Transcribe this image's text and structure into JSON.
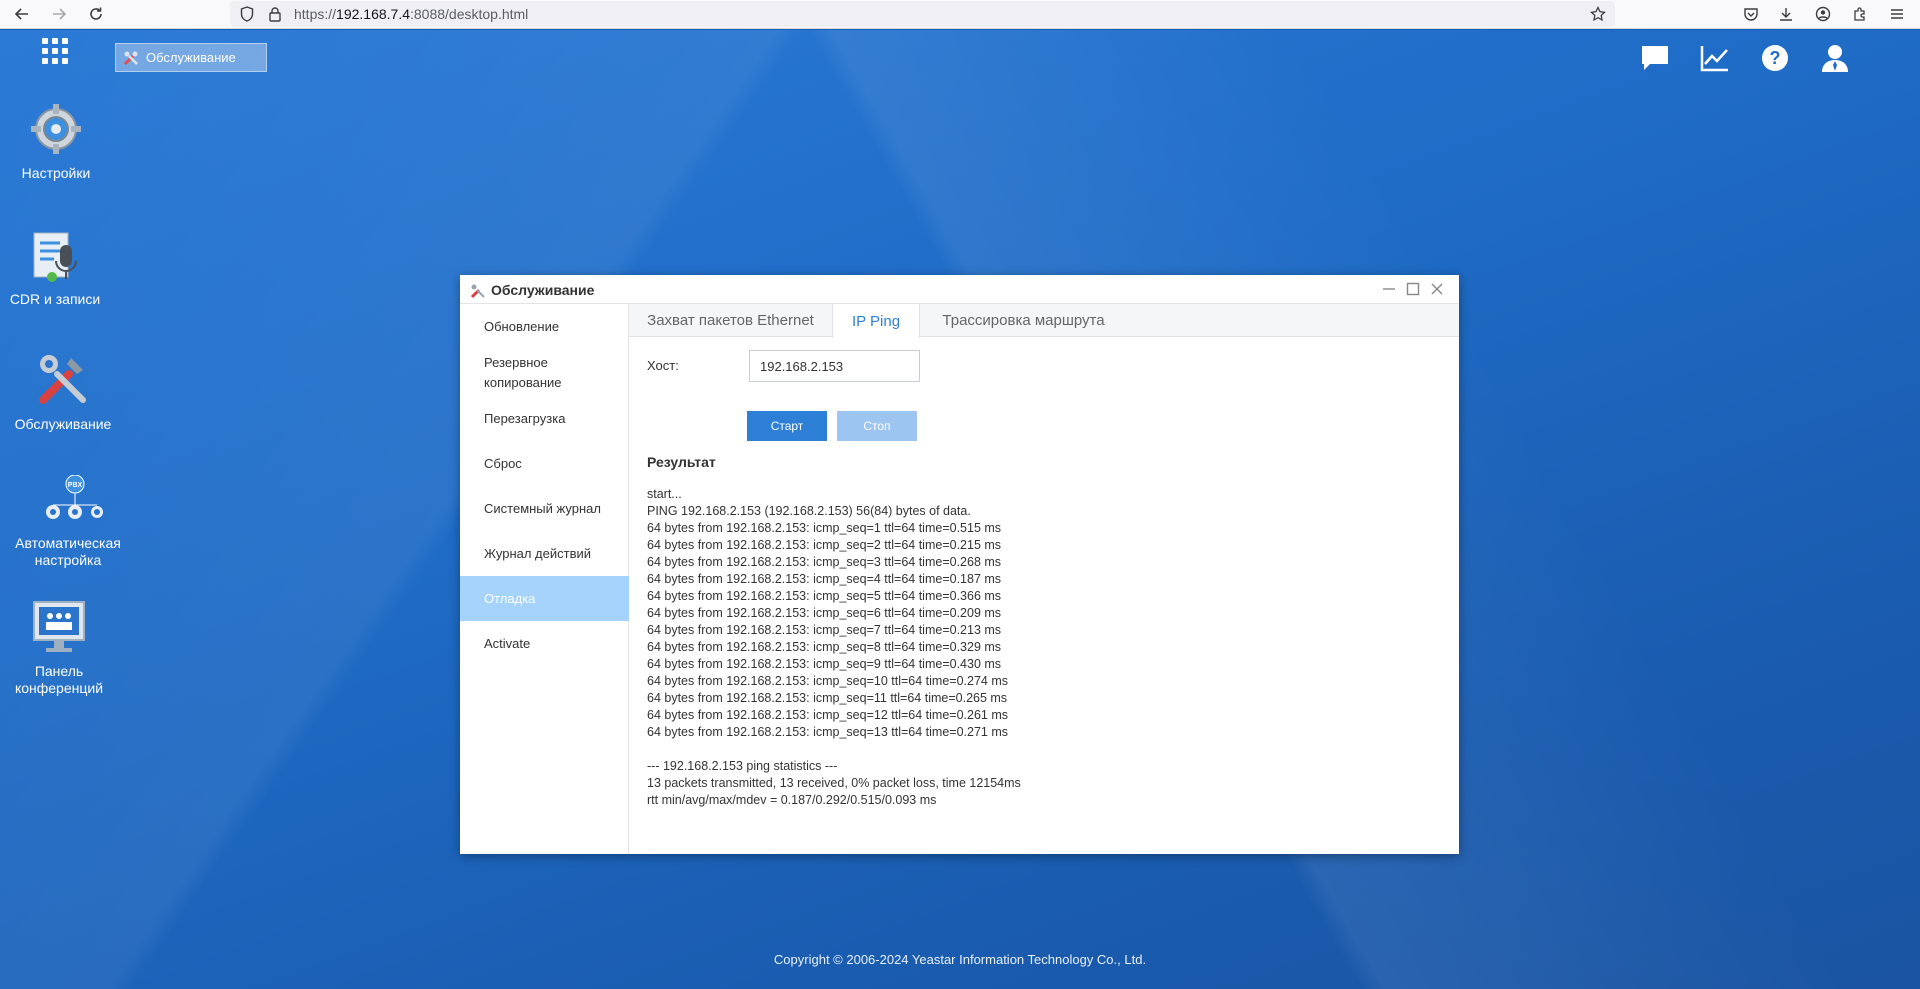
{
  "browser": {
    "url_prefix": "https://",
    "url_host": "192.168.7.4",
    "url_rest": ":8088/desktop.html"
  },
  "desktop": {
    "taskbar_item": "Обслуживание",
    "icons": [
      {
        "label": "Настройки"
      },
      {
        "label": "CDR и записи"
      },
      {
        "label": "Обслуживание"
      },
      {
        "label": "Автоматическая настройка"
      },
      {
        "label": "Панель конференций"
      }
    ],
    "pbx_badge": "PBX",
    "copyright": "Copyright © 2006-2024 Yeastar Information Technology Co., Ltd."
  },
  "window": {
    "title": "Обслуживание",
    "nav": [
      {
        "label": "Обновление"
      },
      {
        "label": "Резервное копирование"
      },
      {
        "label": "Перезагрузка"
      },
      {
        "label": "Сброс"
      },
      {
        "label": "Системный журнал"
      },
      {
        "label": "Журнал действий"
      },
      {
        "label": "Отладка"
      },
      {
        "label": "Activate"
      }
    ],
    "tabs": [
      {
        "label": "Захват пакетов Ethernet"
      },
      {
        "label": "IP Ping"
      },
      {
        "label": "Трассировка маршрута"
      }
    ],
    "host_label": "Хост:",
    "host_value": "192.168.2.153",
    "start_label": "Старт",
    "stop_label": "Стоп",
    "result_title": "Результат",
    "output": [
      "start...",
      "PING 192.168.2.153 (192.168.2.153) 56(84) bytes of data.",
      "64 bytes from 192.168.2.153: icmp_seq=1 ttl=64 time=0.515 ms",
      "64 bytes from 192.168.2.153: icmp_seq=2 ttl=64 time=0.215 ms",
      "64 bytes from 192.168.2.153: icmp_seq=3 ttl=64 time=0.268 ms",
      "64 bytes from 192.168.2.153: icmp_seq=4 ttl=64 time=0.187 ms",
      "64 bytes from 192.168.2.153: icmp_seq=5 ttl=64 time=0.366 ms",
      "64 bytes from 192.168.2.153: icmp_seq=6 ttl=64 time=0.209 ms",
      "64 bytes from 192.168.2.153: icmp_seq=7 ttl=64 time=0.213 ms",
      "64 bytes from 192.168.2.153: icmp_seq=8 ttl=64 time=0.329 ms",
      "64 bytes from 192.168.2.153: icmp_seq=9 ttl=64 time=0.430 ms",
      "64 bytes from 192.168.2.153: icmp_seq=10 ttl=64 time=0.274 ms",
      "64 bytes from 192.168.2.153: icmp_seq=11 ttl=64 time=0.265 ms",
      "64 bytes from 192.168.2.153: icmp_seq=12 ttl=64 time=0.261 ms",
      "64 bytes from 192.168.2.153: icmp_seq=13 ttl=64 time=0.271 ms",
      "",
      "--- 192.168.2.153 ping statistics ---",
      "13 packets transmitted, 13 received, 0% packet loss, time 12154ms",
      "rtt min/avg/max/mdev = 0.187/0.292/0.515/0.093 ms"
    ]
  },
  "colors": {
    "accent": "#2e7fd6",
    "nav_active": "#a6d3fb",
    "stop_disabled": "#9cc5f1"
  }
}
